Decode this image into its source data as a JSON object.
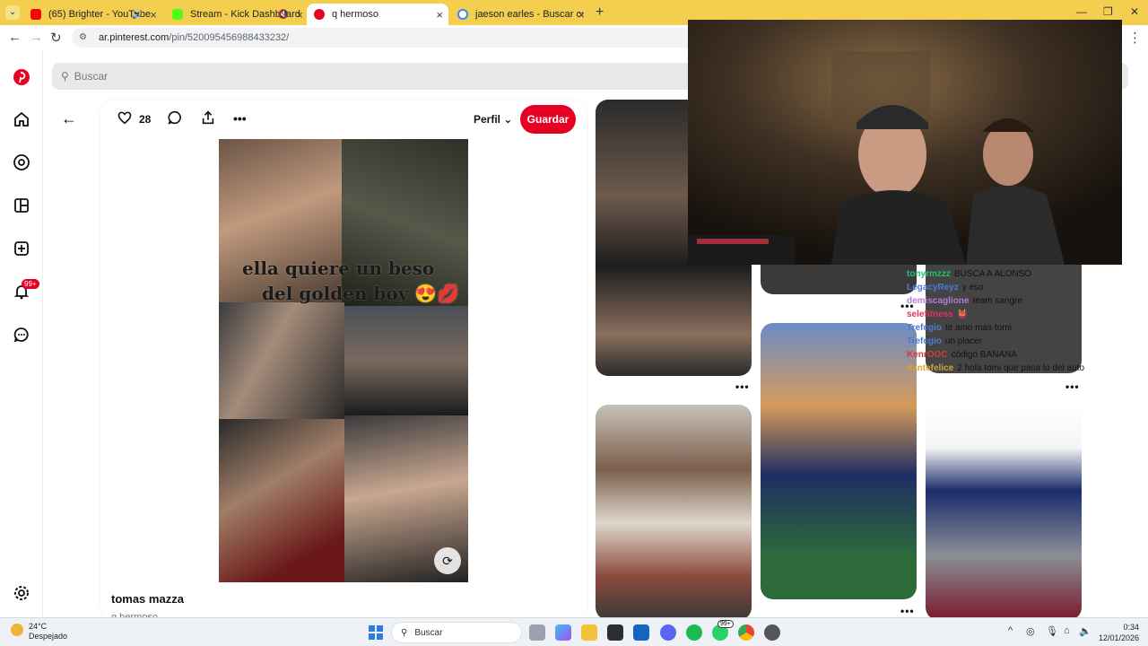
{
  "browser": {
    "tabs": [
      {
        "title": "(65) Brighter - YouTube",
        "favicon_color": "#ff0000",
        "active": false,
        "audio": true
      },
      {
        "title": "Stream - Kick Dashboard",
        "favicon_color": "#53fc18",
        "active": false,
        "muted": true
      },
      {
        "title": "q hermoso",
        "favicon_color": "#e60023",
        "active": true
      },
      {
        "title": "jaeson earles - Buscar con Goo...",
        "favicon_color": "#4285f4",
        "active": false
      }
    ],
    "url": {
      "host": "ar.pinterest.com",
      "path": "/pin/520095456988433232/"
    }
  },
  "pinterest": {
    "search_placeholder": "Buscar",
    "sidebar_badge": "99+",
    "pin": {
      "likes": "28",
      "profile_label": "Perfil",
      "save_label": "Guardar",
      "overlay_line1": "ella quiere un beso",
      "overlay_line2": "del golden boy 😍💋",
      "title": "tomas mazza",
      "subtitle": "q hermoso"
    }
  },
  "stream_chat": [
    {
      "user": "tonyrmzzz",
      "message": "BUSCA A ALONSO",
      "color": "#21c56b"
    },
    {
      "user": "LegacyReyz",
      "message": "y eso",
      "color": "#4a7bd6"
    },
    {
      "user": "demiscaglione",
      "message": "team sangre",
      "color": "#b57ad6"
    },
    {
      "user": "selefitness",
      "message": "👹",
      "color": "#e0335c"
    },
    {
      "user": "Trefcgio",
      "message": "te amo mas tomi",
      "color": "#4a7bd6"
    },
    {
      "user": "Trefcgio",
      "message": "un placer",
      "color": "#4a7bd6"
    },
    {
      "user": "KenrOOC",
      "message": "código BANANA",
      "color": "#d63a3a"
    },
    {
      "user": "dantefelice",
      "message": "2 hola tomi que pasa lo del auto",
      "color": "#d6a23a"
    }
  ],
  "taskbar": {
    "weather_temp": "24°C",
    "weather_desc": "Despejado",
    "search_label": "Buscar",
    "time": "0:34",
    "date": "12/01/2026",
    "notif_badge": "99+"
  },
  "colors": {
    "accent": "#e60023",
    "tabstrip": "#f3ce4f"
  }
}
